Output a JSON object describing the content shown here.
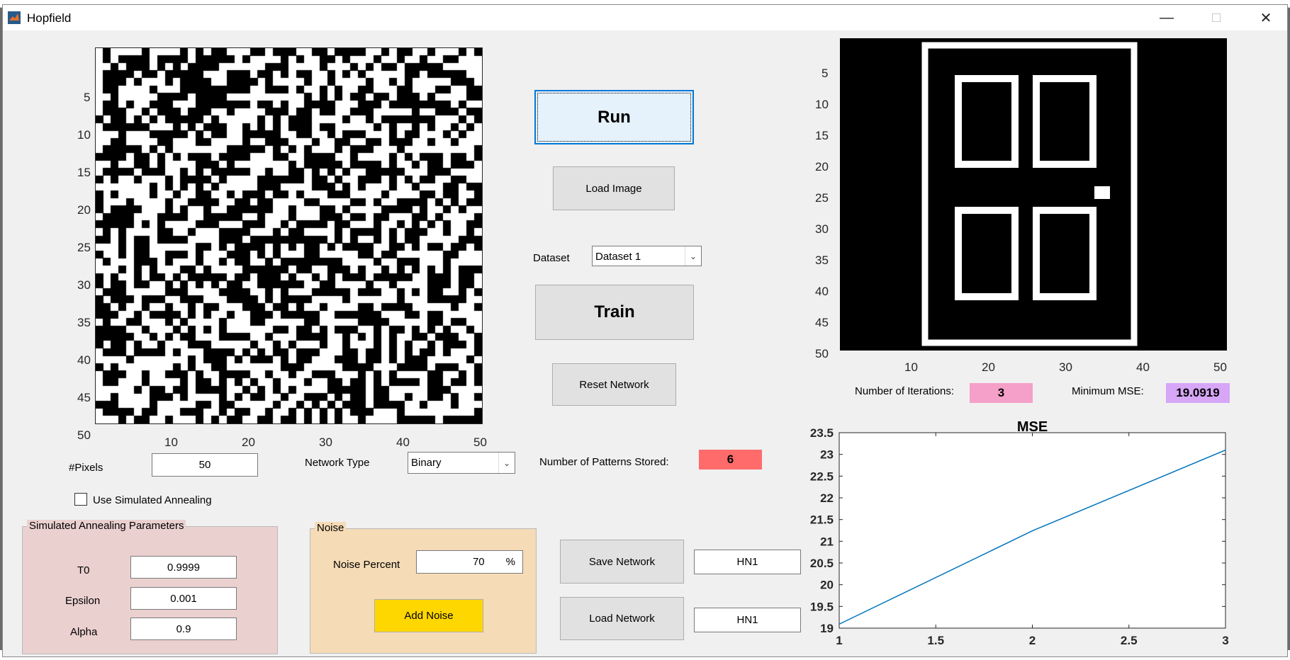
{
  "window": {
    "title": "Hopfield",
    "accent": "#d95319"
  },
  "left_axes": {
    "yticks": [
      "5",
      "10",
      "15",
      "20",
      "25",
      "30",
      "35",
      "40",
      "45",
      "50"
    ],
    "xticks": [
      "10",
      "20",
      "30",
      "40",
      "50"
    ],
    "image": "random binary noise pattern 50x50"
  },
  "right_axes": {
    "yticks": [
      "5",
      "10",
      "15",
      "20",
      "25",
      "30",
      "35",
      "40",
      "45",
      "50"
    ],
    "xticks": [
      "10",
      "20",
      "30",
      "40",
      "50"
    ],
    "image": "door pattern 50x50"
  },
  "buttons": {
    "run": "Run",
    "load_image": "Load Image",
    "train": "Train",
    "reset_network": "Reset Network",
    "save_network": "Save Network",
    "load_network": "Load Network",
    "add_noise": "Add Noise"
  },
  "dataset": {
    "label": "Dataset",
    "selected": "Dataset 1"
  },
  "pixels": {
    "label": "#Pixels",
    "value": "50"
  },
  "network_type": {
    "label": "Network Type",
    "selected": "Binary"
  },
  "patterns": {
    "label": "Number of Patterns Stored:",
    "value": "6",
    "color": "#ff6b6b"
  },
  "iterations": {
    "label": "Number of Iterations:",
    "value": "3",
    "color": "#f5a0c8"
  },
  "min_mse": {
    "label": "Minimum MSE:",
    "value": "19.0919",
    "color": "#d7a6f7"
  },
  "simulated_annealing": {
    "checkbox_label": "Use Simulated Annealing",
    "checked": false
  },
  "sa_params": {
    "title": "Simulated Annealing Parameters",
    "t0_label": "T0",
    "t0": "0.9999",
    "epsilon_label": "Epsilon",
    "epsilon": "0.001",
    "alpha_label": "Alpha",
    "alpha": "0.9"
  },
  "noise": {
    "title": "Noise",
    "percent_label": "Noise Percent",
    "percent": "70",
    "unit": "%"
  },
  "network_names": {
    "save": "HN1",
    "load": "HN1"
  },
  "chart_data": {
    "type": "line",
    "title": "MSE",
    "x": [
      1,
      2,
      3
    ],
    "series": [
      {
        "values": [
          19.0919,
          21.24,
          23.1
        ],
        "color": "#0072bd"
      }
    ],
    "xlim": [
      1,
      3
    ],
    "ylim": [
      19,
      23.5
    ],
    "xticks": [
      "1",
      "1.5",
      "2",
      "2.5",
      "3"
    ],
    "yticks": [
      "19",
      "19.5",
      "20",
      "20.5",
      "21",
      "21.5",
      "22",
      "22.5",
      "23",
      "23.5"
    ]
  }
}
